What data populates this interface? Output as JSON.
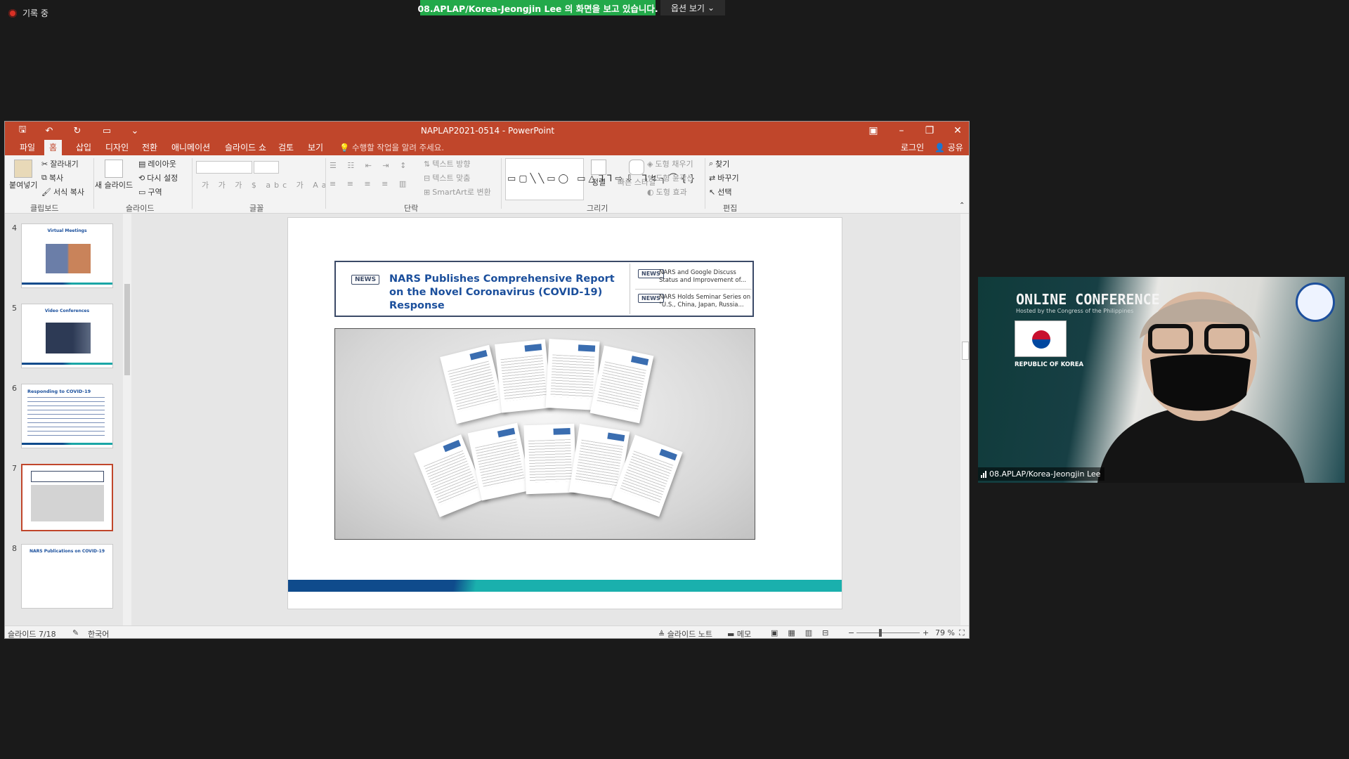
{
  "zoom": {
    "recording_label": "기록 중",
    "share_banner": "08.APLAP/Korea-Jeongjin  Lee 의 화면을 보고 있습니다.",
    "view_options": "옵션 보기"
  },
  "ppt": {
    "title": "NAPLAP2021-0514  -  PowerPoint",
    "menu": [
      "파일",
      "홈",
      "삽입",
      "디자인",
      "전환",
      "애니메이션",
      "슬라이드 쇼",
      "검토",
      "보기"
    ],
    "active_menu": "홈",
    "tell_me": "수행할 작업을 알려 주세요.",
    "sign_in": "로그인",
    "share": "공유",
    "ribbon": {
      "clipboard": {
        "paste": "붙여넣기",
        "cut": "잘라내기",
        "copy": "복사",
        "format_painter": "서식 복사",
        "label": "클립보드"
      },
      "slides": {
        "new_slide": "새 슬라이드",
        "layout": "레이아웃",
        "reset": "다시 설정",
        "section": "구역",
        "label": "슬라이드"
      },
      "font": {
        "label": "글꼴"
      },
      "paragraph": {
        "text_direction": "텍스트 방향",
        "align_text": "텍스트 맞춤",
        "smartart": "SmartArt로 변환",
        "label": "단락"
      },
      "drawing": {
        "arrange": "정렬",
        "quick_styles": "빠른 스타일",
        "shape_fill": "도형 채우기",
        "shape_outline": "도형 윤곽선",
        "shape_effects": "도형 효과",
        "label": "그리기"
      },
      "editing": {
        "find": "찾기",
        "replace": "바꾸기",
        "select": "선택",
        "label": "편집"
      }
    },
    "thumbnails": [
      {
        "num": "4",
        "title": "Virtual Meetings"
      },
      {
        "num": "5",
        "title": "Video Conferences"
      },
      {
        "num": "6",
        "title": "Responding to COVID-19"
      },
      {
        "num": "7",
        "title": ""
      },
      {
        "num": "8",
        "title": "NARS Publications on COVID-19"
      }
    ],
    "slide": {
      "news_tag": "NEWS",
      "headline": "NARS Publishes Comprehensive Report on the Novel Coronavirus (COVID-19) Response",
      "side_news": [
        {
          "tag": "NEWS",
          "text": "NARS and Google Discuss Status and Improvement of..."
        },
        {
          "tag": "NEWS",
          "text": "NARS Holds Seminar Series on \"U.S., China, Japan, Russia..."
        }
      ]
    },
    "status": {
      "slide_pos": "슬라이드 7/18",
      "language": "한국어",
      "notes": "슬라이드 노트",
      "comments": "메모",
      "zoom": "79 %"
    }
  },
  "video": {
    "name": "08.APLAP/Korea-Jeongjin Lee",
    "banner_text": "ONLINE CONFERENCE",
    "banner_sub": "Hosted by the Congress of the Philippines",
    "country": "REPUBLIC OF KOREA"
  }
}
